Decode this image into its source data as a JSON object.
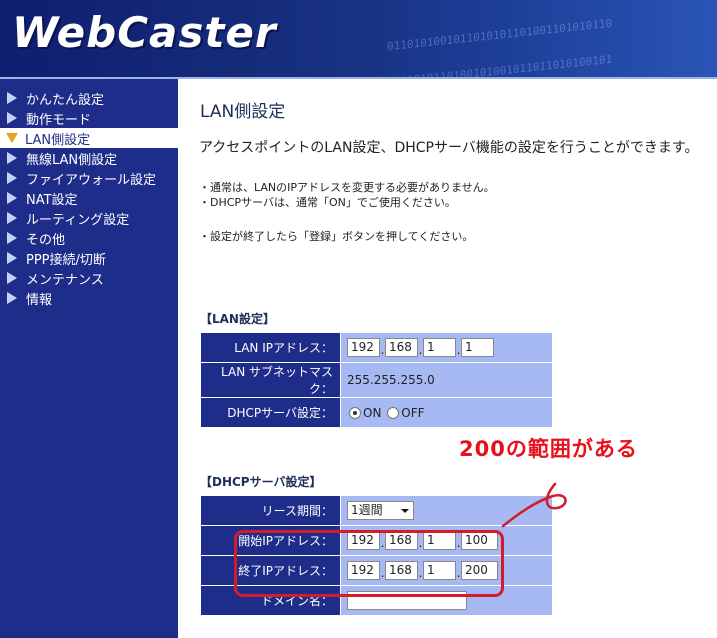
{
  "header": {
    "logo": "WebCaster",
    "bits_pattern": "0110101001011010 1001010110100101 0101101010011010"
  },
  "colors": {
    "sidebar_bg": "#1f2d8a",
    "label_cell": "#1f2d8a",
    "value_cell": "#a6b9f2",
    "annotation_red": "#e8111b"
  },
  "sidebar": {
    "items": [
      {
        "label": "かんたん設定",
        "icon": "right-arrow-icon"
      },
      {
        "label": "動作モード",
        "icon": "right-arrow-icon"
      },
      {
        "label": "LAN側設定",
        "icon": "down-arrow-icon",
        "active": true
      },
      {
        "label": "無線LAN側設定",
        "icon": "right-arrow-icon"
      },
      {
        "label": "ファイアウォール設定",
        "icon": "right-arrow-icon"
      },
      {
        "label": "NAT設定",
        "icon": "right-arrow-icon"
      },
      {
        "label": "ルーティング設定",
        "icon": "right-arrow-icon"
      },
      {
        "label": "その他",
        "icon": "right-arrow-icon"
      },
      {
        "label": "PPP接続/切断",
        "icon": "right-arrow-icon"
      },
      {
        "label": "メンテナンス",
        "icon": "right-arrow-icon"
      },
      {
        "label": "情報",
        "icon": "right-arrow-icon"
      }
    ]
  },
  "main": {
    "title": "LAN側設定",
    "description": "アクセスポイントのLAN設定、DHCPサーバ機能の設定を行うことができます。",
    "notes": [
      "・通常は、LANのIPアドレスを変更する必要がありません。",
      "・DHCPサーバは、通常「ON」でご使用ください。",
      "・設定が終了したら「登録」ボタンを押してください。"
    ],
    "lan_section": {
      "title": "【LAN設定】",
      "ip_label": "LAN IPアドレス：",
      "ip": [
        "192",
        "168",
        "1",
        "1"
      ],
      "mask_label": "LAN サブネットマスク：",
      "mask": "255.255.255.0",
      "dhcp_label": "DHCPサーバ設定：",
      "dhcp_on": "ON",
      "dhcp_off": "OFF",
      "dhcp_selected": "ON"
    },
    "dhcp_section": {
      "title": "【DHCPサーバ設定】",
      "lease_label": "リース期間：",
      "lease_value": "1週間",
      "start_label": "開始IPアドレス：",
      "start_ip": [
        "192",
        "168",
        "1",
        "100"
      ],
      "end_label": "終了IPアドレス：",
      "end_ip": [
        "192",
        "168",
        "1",
        "200"
      ],
      "domain_label": "ドメイン名：",
      "domain_value": ""
    }
  },
  "annotation": {
    "text": "200の範囲がある"
  }
}
